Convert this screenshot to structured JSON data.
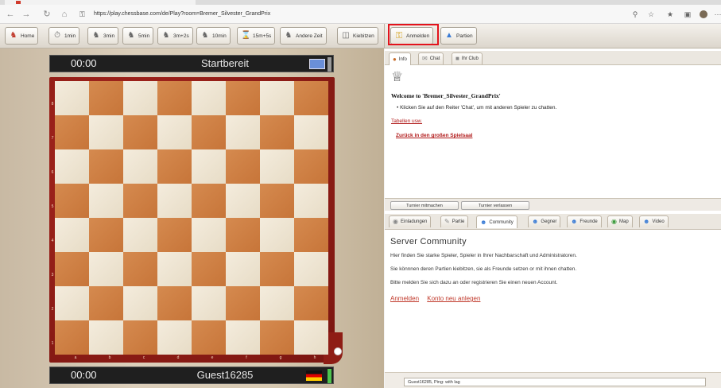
{
  "browser": {
    "url": "https://play.chessbase.com/de/Play?room=Bremer_Silvester_GrandPrix",
    "nav_back": "←",
    "nav_forward": "→",
    "nav_reload": "↻",
    "nav_home": "⌂",
    "lock_icon": "🔒"
  },
  "toolbar": {
    "buttons": [
      {
        "label": "Home",
        "icon": "home-icon"
      },
      {
        "label": "1min",
        "icon": "clock-icon"
      },
      {
        "label": "3min",
        "icon": "knight-icon"
      },
      {
        "label": "5min",
        "icon": "knight-icon"
      },
      {
        "label": "3m+2s",
        "icon": "knight-icon"
      },
      {
        "label": "10min",
        "icon": "knight-icon"
      },
      {
        "label": "15m+5s",
        "icon": "hourglass-icon"
      },
      {
        "label": "Andere Zeit",
        "icon": "knight-icon"
      },
      {
        "label": "Kiebitzen",
        "icon": "monitor-icon"
      }
    ]
  },
  "right_toolbar": {
    "anmelden": "Anmelden",
    "partien": "Partien"
  },
  "board": {
    "top_player": {
      "time": "00:00",
      "name": "Startbereit"
    },
    "bottom_player": {
      "time": "00:00",
      "name": "Guest16285"
    },
    "ranks": [
      "8",
      "7",
      "6",
      "5",
      "4",
      "3",
      "2",
      "1"
    ],
    "files": [
      "a",
      "b",
      "c",
      "d",
      "e",
      "f",
      "g",
      "h"
    ]
  },
  "info_tabs": [
    "Info",
    "Chat",
    "Ihr Club"
  ],
  "info": {
    "welcome": "Welcome to 'Bremer_Silvester_GrandPrix'",
    "bullet": "Klicken Sie auf den Reiter 'Chat', um mit anderen Spieler zu chatten.",
    "link_tables": "Tabellen usw.",
    "link_back": "Zurück in den großen Spielsaal"
  },
  "turnier": {
    "join": "Turnier mitmachen",
    "leave": "Turnier verlassen"
  },
  "community_tabs": [
    "Einladungen",
    "Partie",
    "Community",
    "Gegner",
    "Freunde",
    "Map",
    "Video"
  ],
  "community": {
    "title": "Server Community",
    "line1": "Hier finden Sie starke Spieler, Spieler in Ihrer Nachbarschaft und Administratoren.",
    "line2": "Sie könnnen deren Partien kiebitzen, sie als Freunde setzen or mit ihnen chatten.",
    "line3": "Bitte melden Sie sich dazu an oder registrieren Sie einen neuen Account.",
    "link_login": "Anmelden",
    "link_register": "Konto neu anlegen"
  },
  "status": {
    "text": "Guest16285, Ping: with lag"
  }
}
